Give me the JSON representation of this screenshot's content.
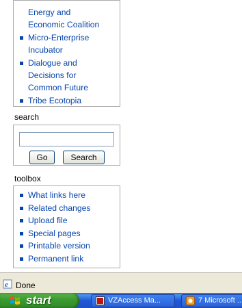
{
  "nav": {
    "items": [
      {
        "lines": [
          "Energy and",
          "Economic Coalition"
        ],
        "bullet": false
      },
      {
        "lines": [
          "Micro-Enterprise",
          "Incubator"
        ],
        "bullet": true
      },
      {
        "lines": [
          "Dialogue and",
          "Decisions for",
          "Common Future"
        ],
        "bullet": true
      },
      {
        "lines": [
          "Tribe Ecotopia"
        ],
        "bullet": true
      }
    ]
  },
  "search": {
    "heading": "search",
    "input_value": "",
    "go_label": "Go",
    "search_label": "Search"
  },
  "toolbox": {
    "heading": "toolbox",
    "items": [
      "What links here",
      "Related changes",
      "Upload file",
      "Special pages",
      "Printable version",
      "Permanent link"
    ]
  },
  "status": {
    "text": "Done",
    "icon": "ie-page-icon"
  },
  "taskbar": {
    "start_label": "start",
    "tasks": [
      {
        "label": "VZAccess Ma...",
        "icon": "vzaccess-icon"
      },
      {
        "label": "7 Microsoft ...",
        "icon": "office-icon"
      }
    ]
  },
  "colors": {
    "link": "#0645ad",
    "taskbar": "#2157d7",
    "start": "#3c9a32"
  }
}
